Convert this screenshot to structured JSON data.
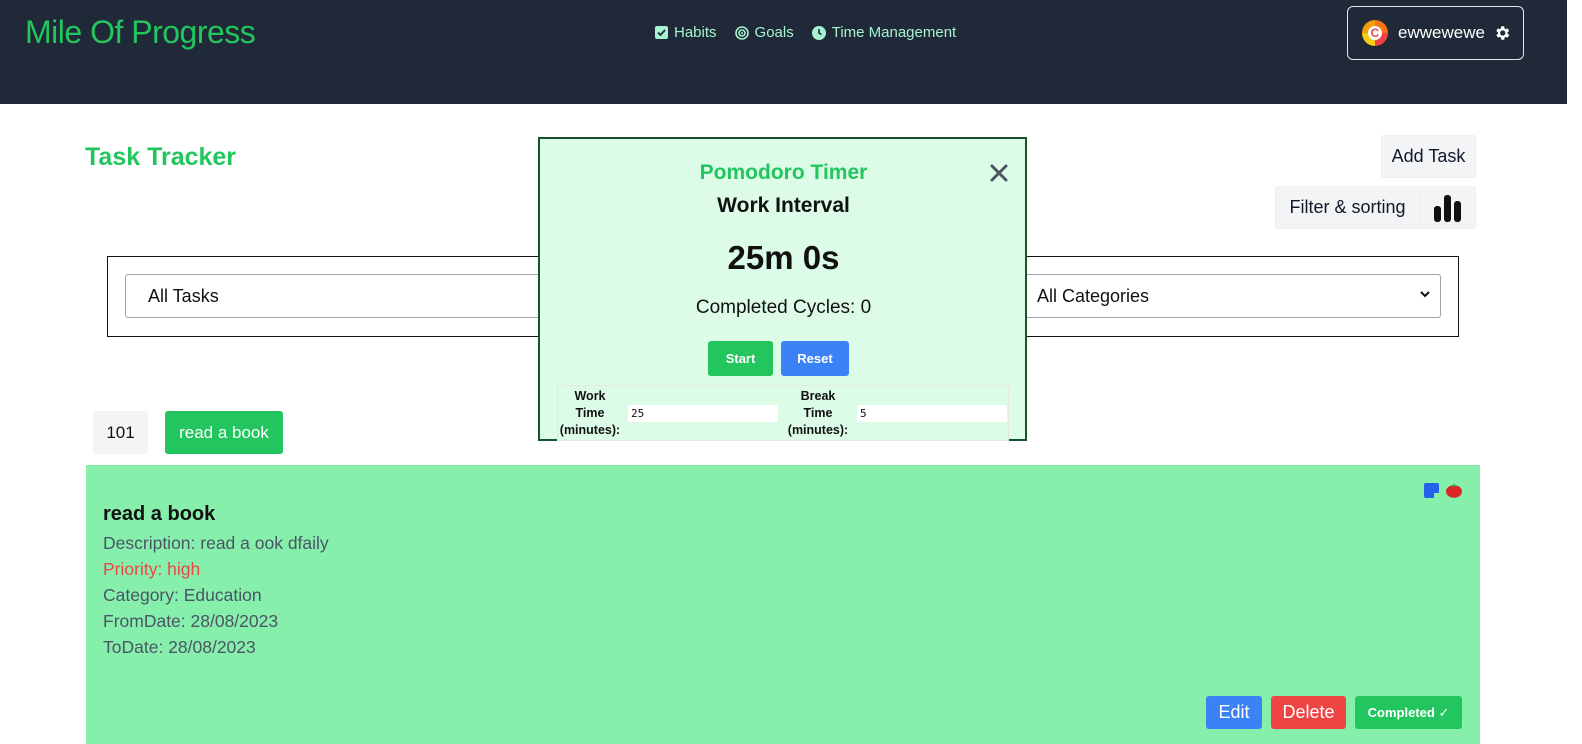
{
  "header": {
    "brand": "Mile Of Progress",
    "nav": [
      {
        "label": "Habits",
        "icon": "checkbox-icon"
      },
      {
        "label": "Goals",
        "icon": "target-icon"
      },
      {
        "label": "Time Management",
        "icon": "clock-icon"
      }
    ],
    "user": {
      "name": "ewwewewe",
      "avatar_letter": "C"
    }
  },
  "main": {
    "title": "Task Tracker",
    "add_task_label": "Add Task",
    "filter_sort_label": "Filter & sorting",
    "filters": {
      "status_selected": "All Tasks",
      "category_selected": "All Categories"
    },
    "task_count": "101",
    "task_chip": "read a book"
  },
  "task_card": {
    "title": "read a book",
    "description": "Description: read a ook dfaily",
    "priority": "Priority: high",
    "category": "Category: Education",
    "from_date": "FromDate: 28/08/2023",
    "to_date": "ToDate: 28/08/2023",
    "edit_label": "Edit",
    "delete_label": "Delete",
    "completed_label": "Completed ✓"
  },
  "pomodoro": {
    "title": "Pomodoro Timer",
    "interval": "Work Interval",
    "time": "25m 0s",
    "cycles": "Completed Cycles: 0",
    "start_label": "Start",
    "reset_label": "Reset",
    "work_label_1": "Work",
    "work_label_2": "Time",
    "work_label_3": "(minutes):",
    "work_value": "25",
    "break_label_1": "Break",
    "break_label_2": "Time",
    "break_label_3": "(minutes):",
    "break_value": "5"
  },
  "colors": {
    "brand": "#22c55e",
    "header_bg": "#1f2937",
    "card_bg": "#86efac",
    "modal_bg": "#dcfce7"
  }
}
